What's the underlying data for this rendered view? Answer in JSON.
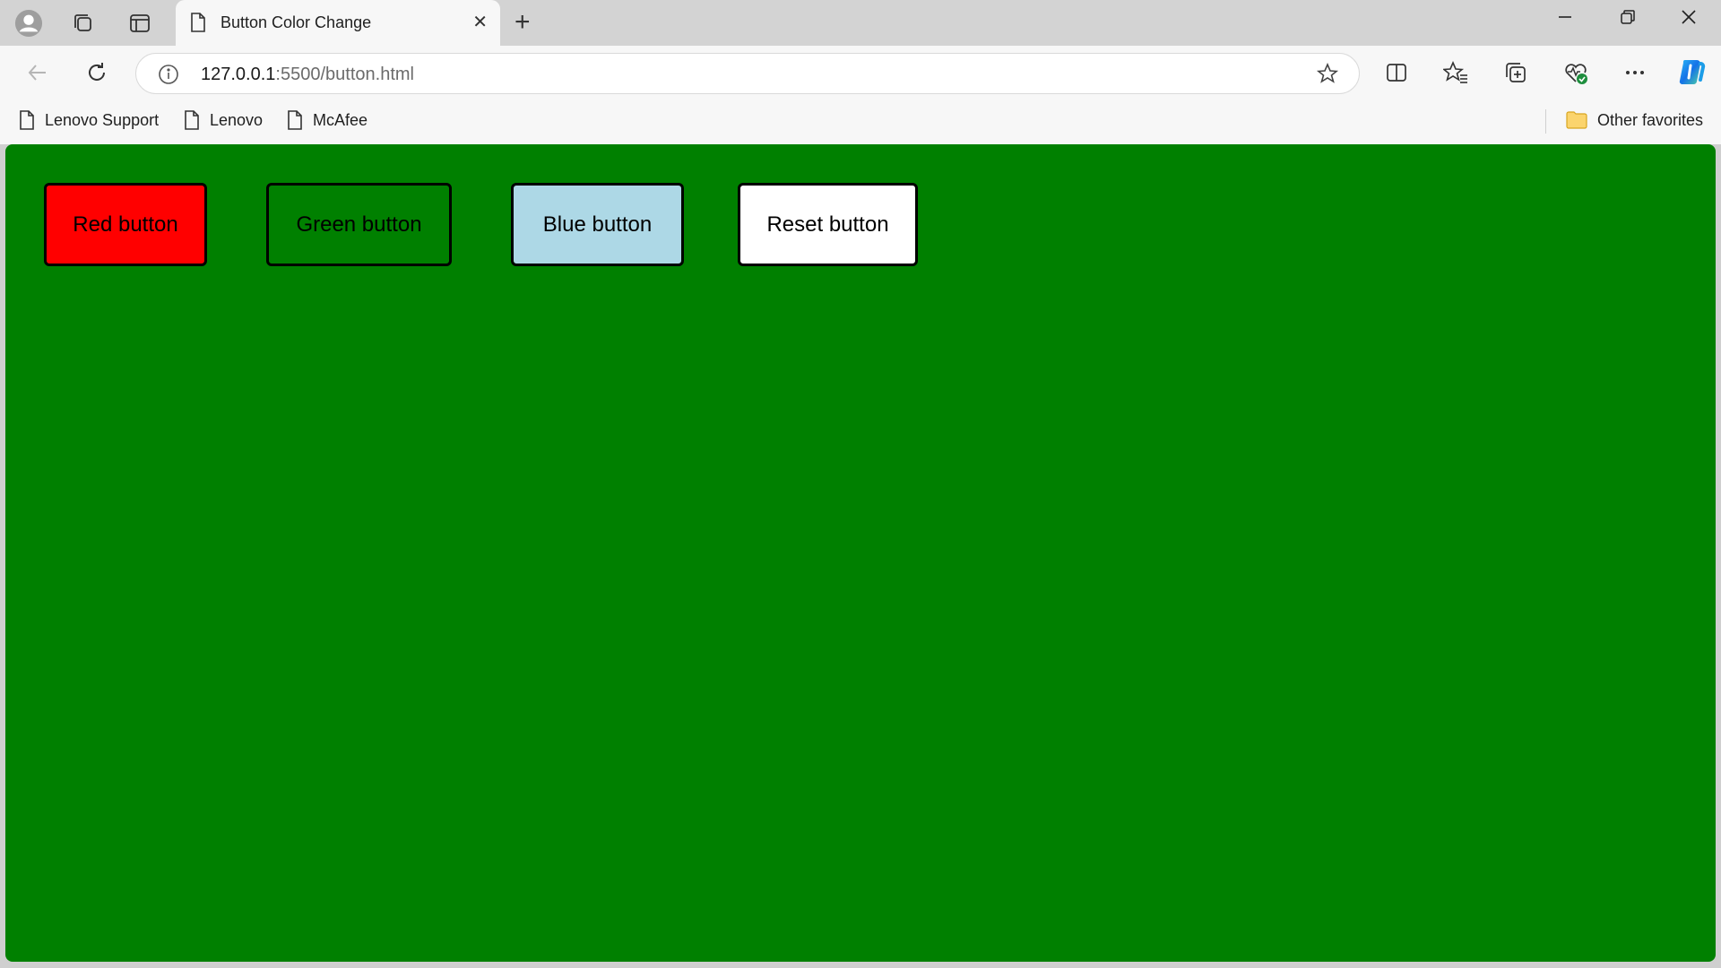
{
  "browser": {
    "tab_title": "Button Color Change",
    "url_host": "127.0.0.1",
    "url_path": ":5500/button.html",
    "bookmarks": [
      "Lenovo Support",
      "Lenovo",
      "McAfee"
    ],
    "other_favorites": "Other favorites"
  },
  "page": {
    "background_color": "#008000",
    "buttons": [
      {
        "label": "Red button",
        "color": "#ff0000"
      },
      {
        "label": "Green button",
        "color": "#008000"
      },
      {
        "label": "Blue button",
        "color": "#add8e6"
      },
      {
        "label": "Reset button",
        "color": "#ffffff"
      }
    ]
  }
}
